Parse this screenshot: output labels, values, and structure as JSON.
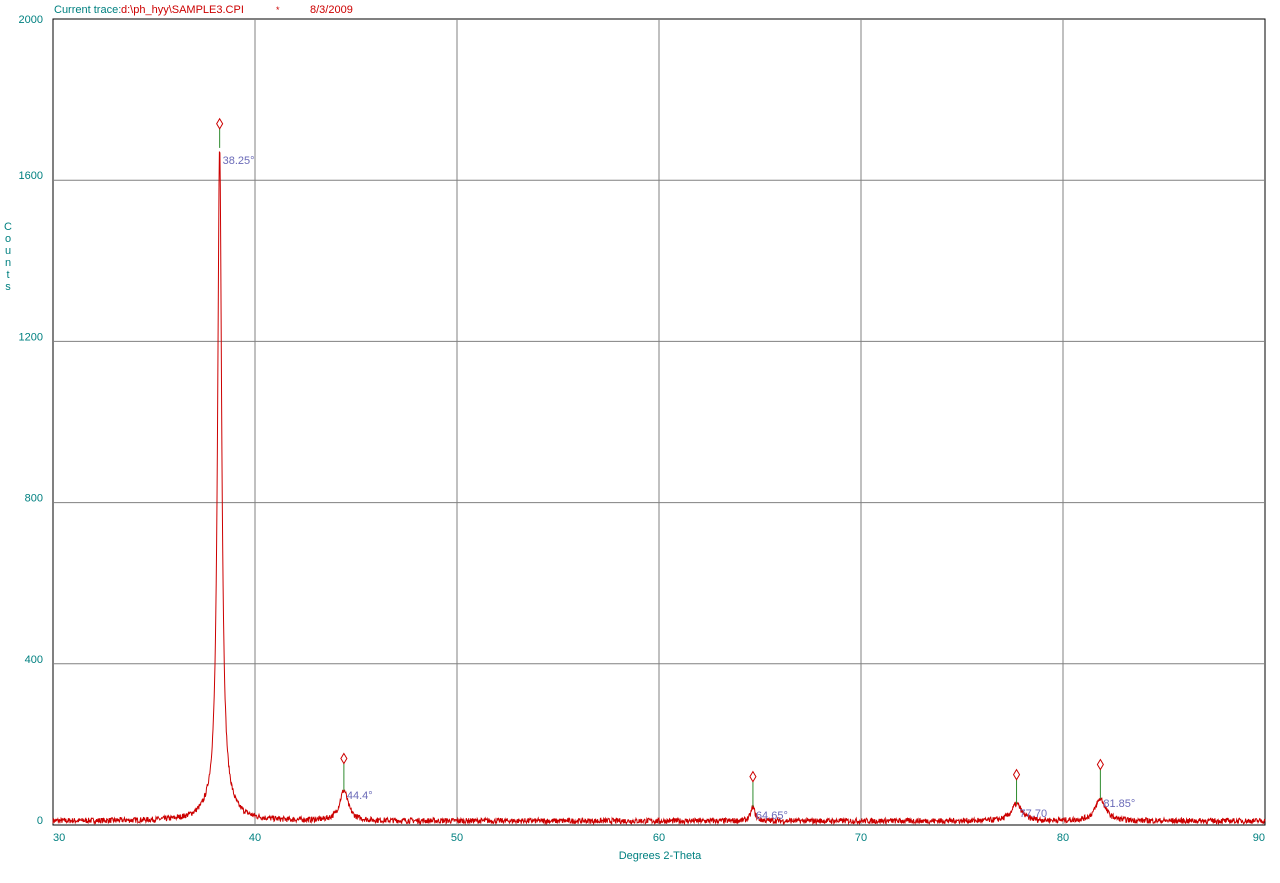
{
  "header": {
    "label": "Current trace:",
    "file": "d:\\ph_hyy\\SAMPLE3.CPI",
    "marker": "*",
    "date": "8/3/2009"
  },
  "colors": {
    "trace": "#cc0000",
    "axis_text": "#008080",
    "grid": "#808080",
    "peak_label": "#6a6ab8",
    "peak_stick": "#2e8b2e"
  },
  "chart_data": {
    "type": "line",
    "title": "",
    "xlabel": "Degrees 2-Theta",
    "ylabel": "Counts",
    "xlim": [
      30,
      90
    ],
    "ylim": [
      0,
      2000
    ],
    "xticks": [
      30,
      40,
      50,
      60,
      70,
      80,
      90
    ],
    "yticks": [
      0,
      400,
      800,
      1200,
      1600,
      2000
    ],
    "grid": true,
    "baseline": 10,
    "peaks": [
      {
        "center": 38.25,
        "height": 1620,
        "width": 0.12,
        "tail": 50,
        "tail_width": 0.6,
        "marker_height": 1740
      },
      {
        "center": 44.4,
        "height": 75,
        "width": 0.25,
        "tail": 0,
        "tail_width": 0,
        "marker_height": 165
      },
      {
        "center": 64.65,
        "height": 35,
        "width": 0.12,
        "tail": 0,
        "tail_width": 0,
        "marker_height": 120
      },
      {
        "center": 77.7,
        "height": 42,
        "width": 0.3,
        "tail": 0,
        "tail_width": 0,
        "marker_height": 125
      },
      {
        "center": 81.85,
        "height": 55,
        "width": 0.3,
        "tail": 0,
        "tail_width": 0,
        "marker_height": 150
      }
    ],
    "peak_labels": [
      {
        "x": 38.25,
        "text": "38.25°",
        "y": 1640
      },
      {
        "x": 44.4,
        "text": "44.4°",
        "y": 65
      },
      {
        "x": 64.65,
        "text": "64.65°",
        "y": 15
      },
      {
        "x": 77.7,
        "text": "77.70",
        "y": 20
      },
      {
        "x": 81.85,
        "text": "81.85°",
        "y": 45
      }
    ]
  }
}
